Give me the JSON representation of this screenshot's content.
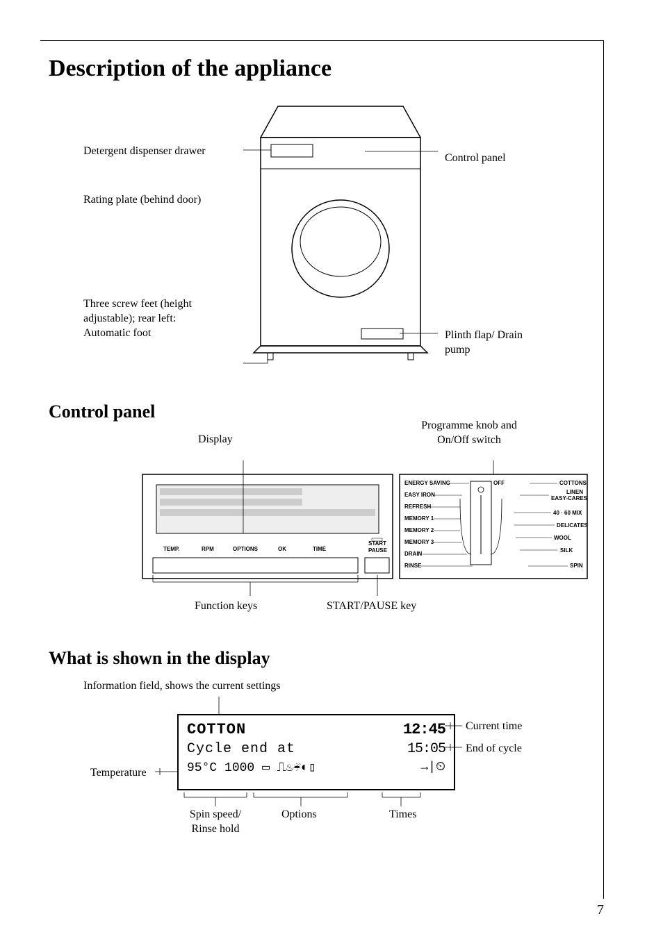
{
  "page_number": "7",
  "title": "Description of the appliance",
  "washing_machine": {
    "labels": {
      "detergent_drawer": "Detergent dispenser drawer",
      "rating_plate": "Rating plate (behind door)",
      "feet": "Three screw feet (height adjustable); rear left: Automatic foot",
      "control_panel": "Control panel",
      "plinth": "Plinth flap/ Drain pump"
    }
  },
  "control_panel": {
    "heading": "Control panel",
    "labels": {
      "display": "Display",
      "knob": "Programme knob and On/Off switch",
      "function_keys": "Function keys",
      "start_pause_key": "START/PAUSE key"
    },
    "keys": [
      "TEMP.",
      "RPM",
      "OPTIONS",
      "OK",
      "TIME",
      "START PAUSE"
    ],
    "knob_programs_left": [
      "ENERGY SAVING",
      "EASY IRON",
      "REFRESH",
      "MEMORY 1",
      "MEMORY 2",
      "MEMORY 3",
      "DRAIN",
      "RINSE"
    ],
    "knob_programs_right": [
      "OFF",
      "COTTONS",
      "LINEN EASY-CARES",
      "40 · 60 MIX",
      "DELICATES",
      "WOOL",
      "SILK",
      "SPIN"
    ]
  },
  "display": {
    "heading": "What is shown in the display",
    "info_label": "Information field, shows the current settings",
    "box": {
      "program": "COTTON",
      "current_time": "12:45",
      "subtitle": "Cycle end at",
      "end_time": "15:05",
      "temp": "95°C",
      "spin": "1000"
    },
    "labels": {
      "temperature": "Temperature",
      "current_time": "Current time",
      "end_of_cycle": "End of cycle",
      "spin_speed": "Spin speed/ Rinse hold",
      "options": "Options",
      "times": "Times"
    }
  }
}
